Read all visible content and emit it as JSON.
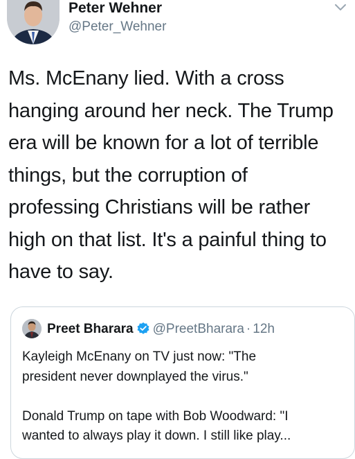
{
  "author": {
    "name": "Peter Wehner",
    "handle": "@Peter_Wehner"
  },
  "tweet": {
    "lines": [
      "Ms. McEnany lied. With a cross",
      "hanging around her neck. The Trump",
      "era will be known for a lot of terrible",
      "things, but the corruption of",
      "professing Christians will be rather",
      "high on that list. It's a painful thing to",
      "have to say."
    ]
  },
  "quoted": {
    "name": "Preet Bharara",
    "handle": "@PreetBharara",
    "separator": "·",
    "time": "12h",
    "paragraph1": [
      "Kayleigh McEnany on TV just now: \"The",
      "president never downplayed the virus.\""
    ],
    "paragraph2": [
      "Donald Trump on tape with Bob Woodward: \"I",
      "wanted to always play it down. I still like play..."
    ]
  },
  "colors": {
    "text": "#14171a",
    "secondary": "#657786",
    "border": "#ccd6dd",
    "verified": "#1da1f2"
  },
  "icons": {
    "menu": "chevron-down-icon",
    "verified": "verified-badge-icon"
  }
}
